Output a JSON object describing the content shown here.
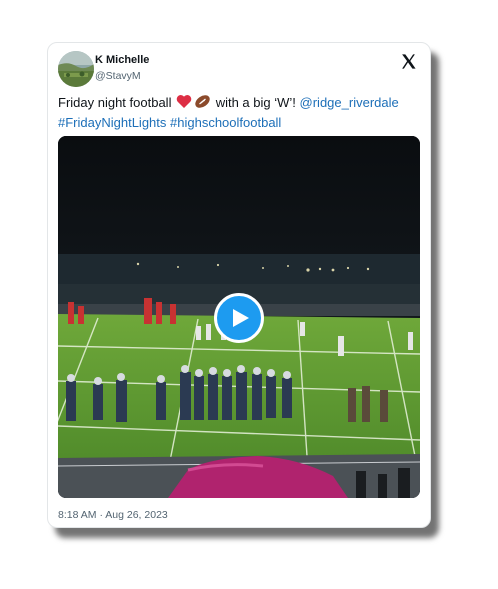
{
  "tweet": {
    "author_name": "K Michelle",
    "author_handle": "@StavyM",
    "text_part1": "Friday night football",
    "text_part2": "with a big ‘W’!",
    "mention": "@ridge_riverdale",
    "hashtag1": "#FridayNightLights",
    "hashtag2": "#highschoolfootball",
    "timestamp": "8:18 AM · Aug 26, 2023"
  },
  "icons": {
    "brand": "x-logo-icon",
    "emoji1": "red-heart-icon",
    "emoji2": "american-football-icon",
    "media_overlay": "play-icon"
  },
  "colors": {
    "link": "#1d6fb8",
    "play_button": "#1d9bf0",
    "text": "#0f1419",
    "muted": "#536471"
  }
}
